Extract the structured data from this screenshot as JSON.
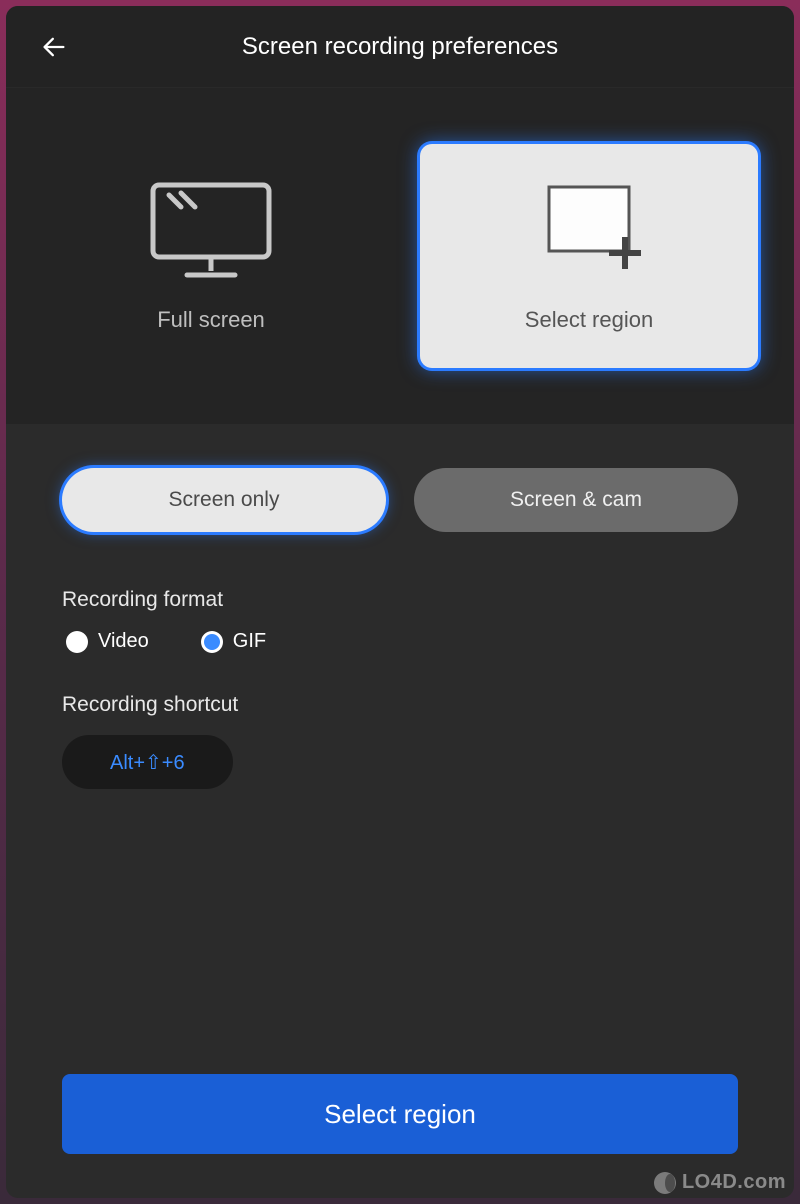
{
  "header": {
    "title": "Screen recording preferences"
  },
  "capture": {
    "full_screen_label": "Full screen",
    "select_region_label": "Select region"
  },
  "mode": {
    "screen_only": "Screen only",
    "screen_cam": "Screen & cam"
  },
  "format": {
    "section_label": "Recording format",
    "video_label": "Video",
    "gif_label": "GIF",
    "selected": "gif"
  },
  "shortcut": {
    "section_label": "Recording shortcut",
    "value": "Alt+⇧+6"
  },
  "primary_action": {
    "label": "Select region"
  },
  "watermark": {
    "text": "LO4D.com"
  }
}
